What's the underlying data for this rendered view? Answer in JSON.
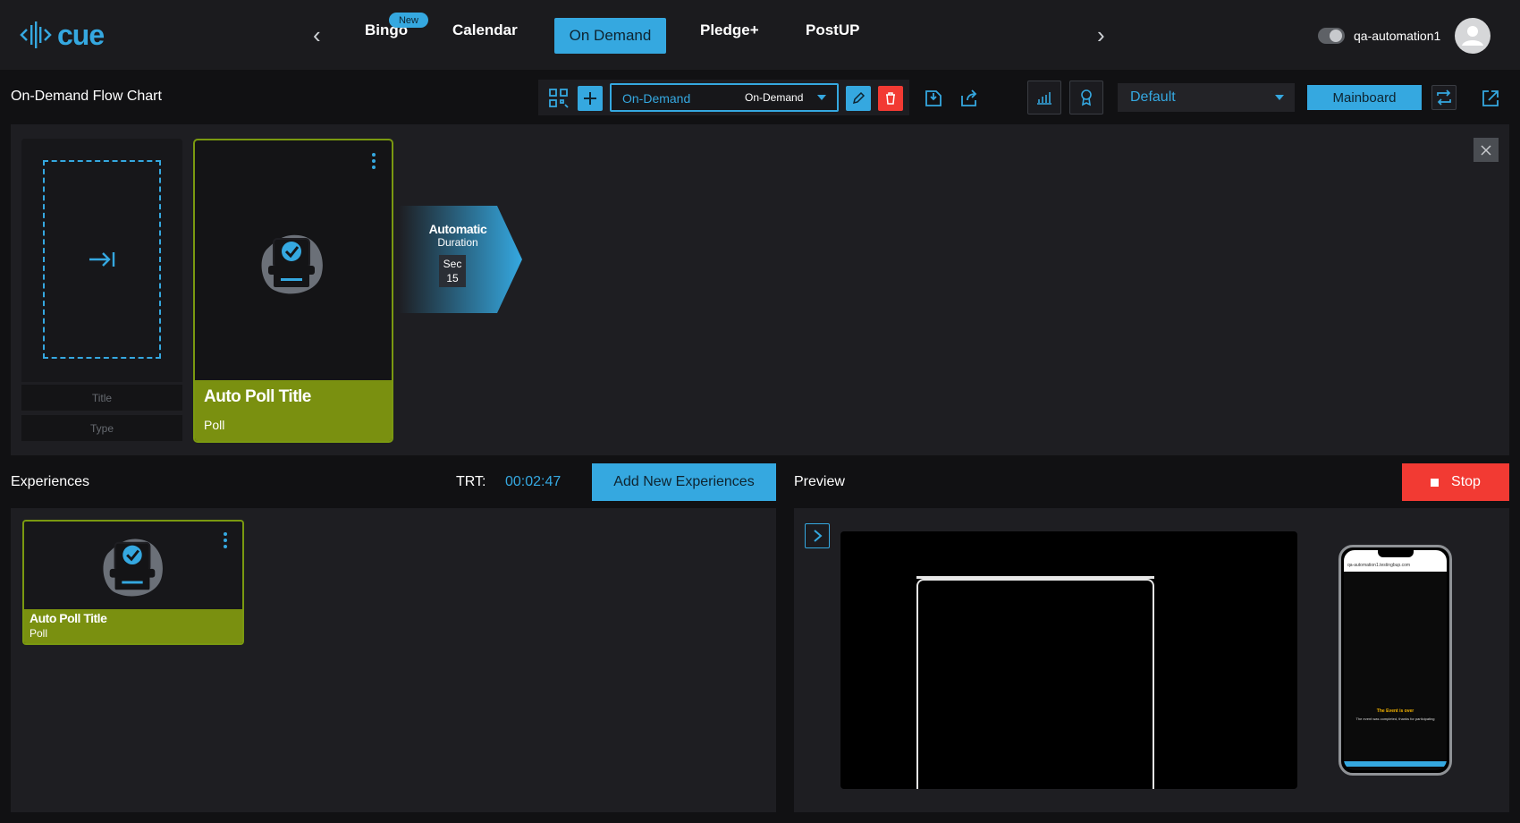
{
  "header": {
    "logo_text": "cue",
    "nav": [
      {
        "label": "Bingo",
        "badge": "New"
      },
      {
        "label": "Calendar"
      },
      {
        "label": "On Demand",
        "active": true
      },
      {
        "label": "Pledge+"
      },
      {
        "label": "PostUP"
      }
    ],
    "user_name": "qa-automation1",
    "accent": "#35a8e0"
  },
  "toolbar": {
    "page_title": "On-Demand Flow Chart",
    "flow_dropdown": {
      "left_value": "On-Demand",
      "right_value": "On-Demand"
    },
    "layout_dropdown": "Default",
    "mainboard_label": "Mainboard"
  },
  "flow": {
    "empty_slot": {
      "title_placeholder": "Title",
      "type_placeholder": "Type"
    },
    "card": {
      "title": "Auto Poll Title",
      "type": "Poll"
    },
    "transition": {
      "mode": "Automatic",
      "label": "Duration",
      "unit": "Sec",
      "value": "15"
    }
  },
  "experiences": {
    "title": "Experiences",
    "trt_label": "TRT:",
    "trt_value": "00:02:47",
    "add_button": "Add New Experiences",
    "items": [
      {
        "title": "Auto Poll Title",
        "type": "Poll"
      }
    ]
  },
  "preview": {
    "title": "Preview",
    "stop_button": "Stop",
    "phone": {
      "url": "qa-automation1.testingbup.com",
      "message_title": "The Event is over",
      "message_body": "The event was completed, thanks for participating"
    }
  }
}
